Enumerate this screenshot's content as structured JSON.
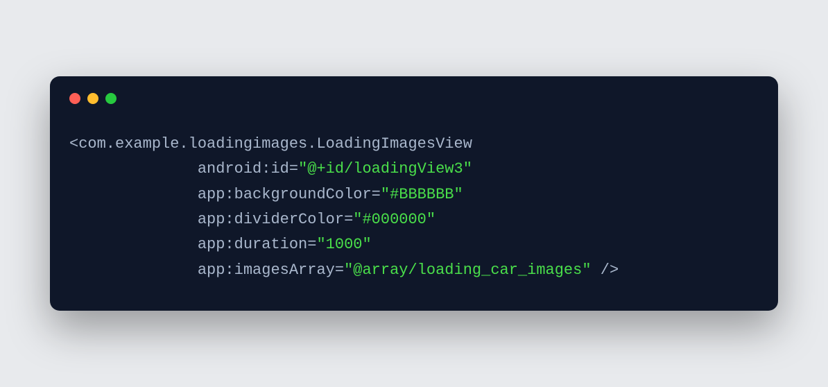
{
  "code": {
    "tagOpen": "<",
    "tagName": "com.example.loadingimages.LoadingImagesView",
    "tagClose": " />",
    "attributes": [
      {
        "name": "android:id",
        "equals": "=",
        "quote": "\"",
        "value": "@+id/loadingView3"
      },
      {
        "name": "app:backgroundColor",
        "equals": "=",
        "quote": "\"",
        "value": "#BBBBBB"
      },
      {
        "name": "app:dividerColor",
        "equals": "=",
        "quote": "\"",
        "value": "#000000"
      },
      {
        "name": "app:duration",
        "equals": "=",
        "quote": "\"",
        "value": "1000"
      },
      {
        "name": "app:imagesArray",
        "equals": "=",
        "quote": "\"",
        "value": "@array/loading_car_images"
      }
    ]
  },
  "windowControls": {
    "close": "close",
    "minimize": "minimize",
    "maximize": "maximize"
  }
}
